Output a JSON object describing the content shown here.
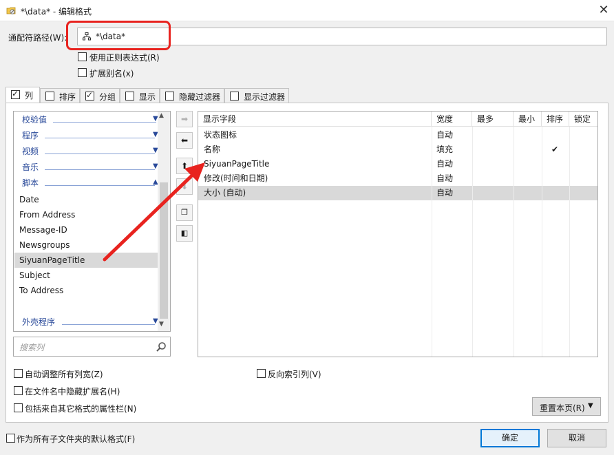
{
  "window": {
    "title": "*\\data* - 编辑格式",
    "close_glyph": "✕",
    "icon": "folder-format-icon"
  },
  "path": {
    "label": "通配符路径(W):",
    "value": "*\\data*",
    "highlight_color": "#e8231f"
  },
  "options_top": {
    "regex": {
      "label": "使用正则表达式(R)",
      "checked": false
    },
    "alias": {
      "label": "扩展别名(x)",
      "checked": false
    }
  },
  "tabs": [
    {
      "label": "列",
      "checked": true,
      "active": true
    },
    {
      "label": "排序",
      "checked": false
    },
    {
      "label": "分组",
      "checked": true
    },
    {
      "label": "显示",
      "checked": false
    },
    {
      "label": "隐藏过滤器",
      "checked": false
    },
    {
      "label": "显示过滤器",
      "checked": false
    }
  ],
  "available_columns": {
    "groups": [
      {
        "label": "校验值",
        "expanded": false
      },
      {
        "label": "程序",
        "expanded": false
      },
      {
        "label": "视频",
        "expanded": false
      },
      {
        "label": "音乐",
        "expanded": false
      },
      {
        "label": "脚本",
        "expanded": true
      },
      {
        "label": "外壳程序",
        "expanded": false
      }
    ],
    "script_items": [
      "Date",
      "From Address",
      "Message-ID",
      "Newsgroups",
      "SiyuanPageTitle",
      "Subject",
      "To Address"
    ],
    "selected": "SiyuanPageTitle"
  },
  "search": {
    "placeholder": "搜索列"
  },
  "middle_buttons": [
    "add-right",
    "remove-left",
    "move-up",
    "move-down",
    "copy",
    "insert-left"
  ],
  "columns_table": {
    "headers": [
      "显示字段",
      "宽度",
      "最多",
      "最小",
      "排序",
      "锁定"
    ],
    "rows": [
      {
        "field": "状态图标",
        "width": "自动",
        "max": "",
        "min": "",
        "sort": "",
        "lock": ""
      },
      {
        "field": "名称",
        "width": "填充",
        "max": "",
        "min": "",
        "sort": "✔",
        "lock": ""
      },
      {
        "field": "SiyuanPageTitle",
        "width": "自动",
        "max": "",
        "min": "",
        "sort": "",
        "lock": ""
      },
      {
        "field": "修改(时间和日期)",
        "width": "自动",
        "max": "",
        "min": "",
        "sort": "",
        "lock": ""
      },
      {
        "field": "大小 (自动)",
        "width": "自动",
        "max": "",
        "min": "",
        "sort": "",
        "lock": ""
      }
    ],
    "selected_row": 4
  },
  "options_bottom": {
    "auto_fit": "自动调整所有列宽(Z)",
    "reverse_index": "反向索引列(V)",
    "hide_ext": "在文件名中隐藏扩展名(H)",
    "include_props": "包括来自其它格式的属性栏(N)",
    "default_subfolders": "作为所有子文件夹的默认格式(F)"
  },
  "buttons": {
    "reset": "重置本页(R)",
    "ok": "确定",
    "cancel": "取消"
  },
  "annotation_arrow_color": "#e8231f"
}
